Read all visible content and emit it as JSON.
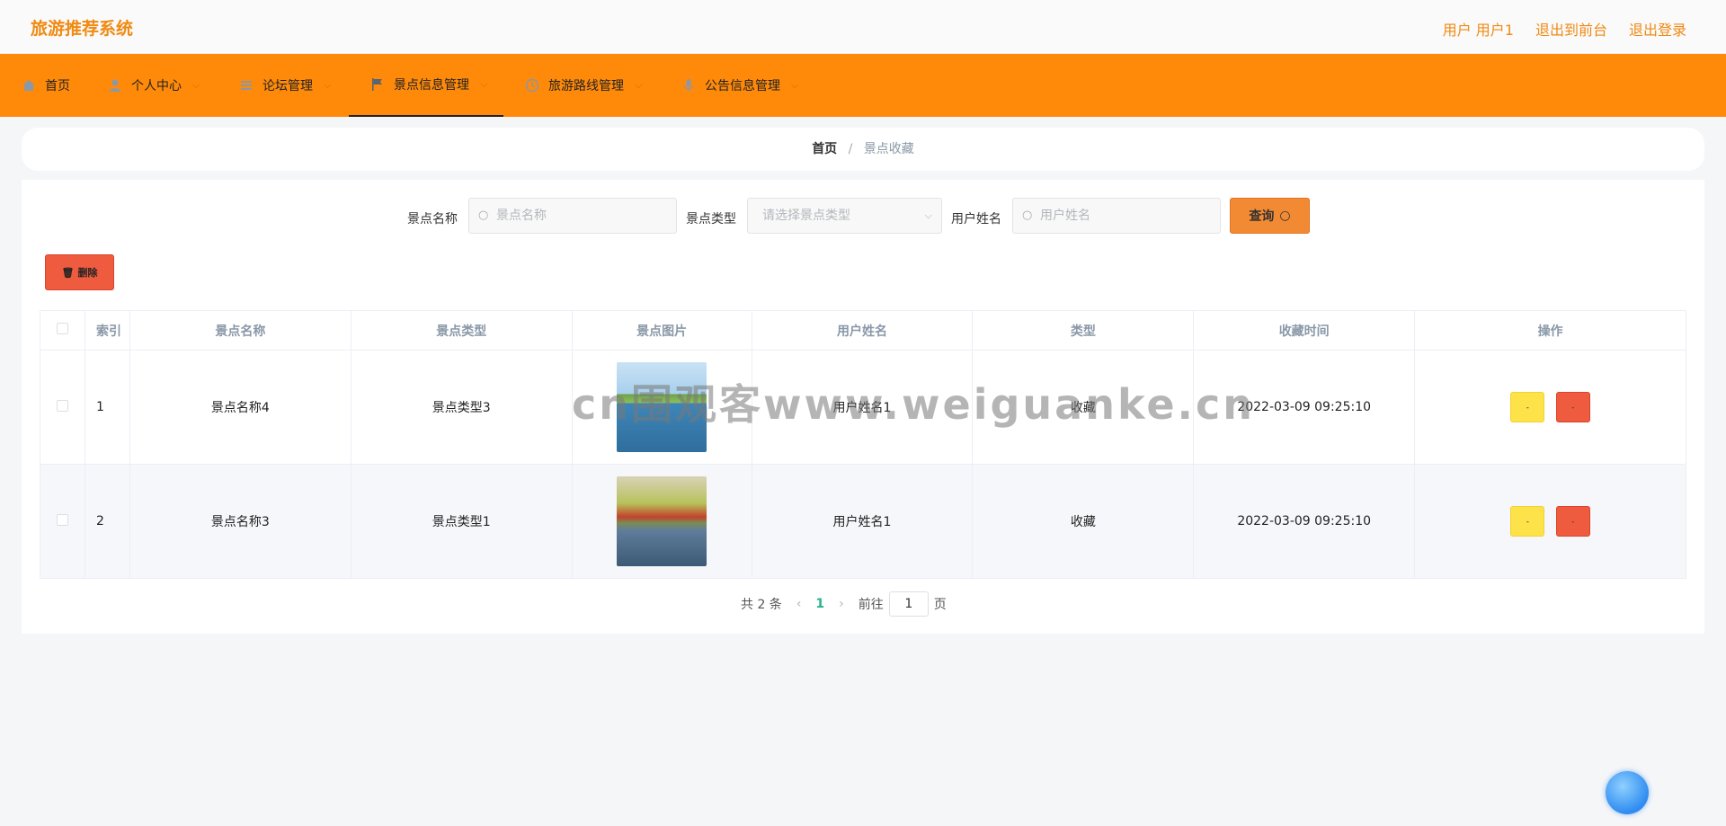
{
  "app": {
    "title": "旅游推荐系统"
  },
  "top_links": {
    "user": "用户 用户1",
    "frontend": "退出到前台",
    "logout": "退出登录"
  },
  "nav": [
    {
      "label": "首页",
      "icon": "home-icon"
    },
    {
      "label": "个人中心",
      "icon": "user-icon"
    },
    {
      "label": "论坛管理",
      "icon": "list-icon"
    },
    {
      "label": "景点信息管理",
      "icon": "flag-icon"
    },
    {
      "label": "旅游路线管理",
      "icon": "clock-icon"
    },
    {
      "label": "公告信息管理",
      "icon": "mic-icon"
    }
  ],
  "breadcrumb": {
    "home": "首页",
    "sep": "/",
    "current": "景点收藏"
  },
  "search": {
    "name_label": "景点名称",
    "name_placeholder": "景点名称",
    "type_label": "景点类型",
    "type_placeholder": "请选择景点类型",
    "user_label": "用户姓名",
    "user_placeholder": "用户姓名",
    "query_label": "查询"
  },
  "toolbar": {
    "delete_label": "删除"
  },
  "table": {
    "headers": [
      "索引",
      "景点名称",
      "景点类型",
      "景点图片",
      "用户姓名",
      "类型",
      "收藏时间",
      "操作"
    ],
    "rows": [
      {
        "index": "1",
        "name": "景点名称4",
        "type": "景点类型3",
        "user": "用户姓名1",
        "kind": "收藏",
        "time": "2022-03-09 09:25:10"
      },
      {
        "index": "2",
        "name": "景点名称3",
        "type": "景点类型1",
        "user": "用户姓名1",
        "kind": "收藏",
        "time": "2022-03-09 09:25:10"
      }
    ],
    "op_label": "-"
  },
  "pager": {
    "total": "共 2 条",
    "current": "1",
    "goto_label": "前往",
    "goto_value": "1",
    "page_suffix": "页"
  },
  "watermark": "cn围观客www.weiguanke.cn",
  "colors": {
    "brand": "#f08a12",
    "nav_bg": "#ff8a0a",
    "query": "#f28a33",
    "delete": "#ef5b3f",
    "edit": "#fde24a",
    "page_active": "#26b38d"
  }
}
